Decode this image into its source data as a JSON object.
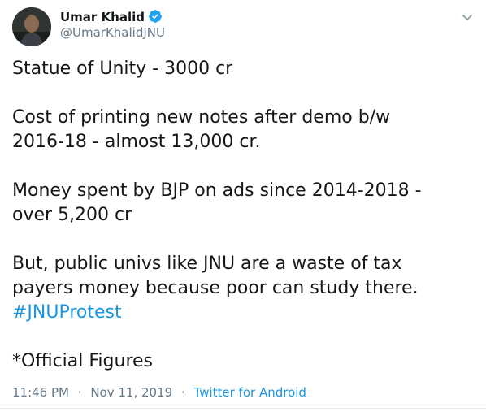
{
  "author": {
    "name": "Umar Khalid",
    "handle": "@UmarKhalidJNU",
    "verified_color": "#1da1f2"
  },
  "tweet": {
    "paragraphs": [
      [
        "Statue of Unity - 3000 cr"
      ],
      [
        "Cost of printing new notes after demo b/w",
        "2016-18 - almost 13,000 cr."
      ],
      [
        "Money spent by BJP on ads since 2014-2018 -",
        "over 5,200 cr"
      ],
      [
        "But, public univs like JNU are a waste of tax",
        "payers money because poor can study there."
      ]
    ],
    "hashtag": "#JNUProtest",
    "footnote": "*Official Figures"
  },
  "meta": {
    "time": "11:46 PM",
    "separator": "·",
    "date": "Nov 11, 2019",
    "source": "Twitter for Android"
  },
  "colors": {
    "link": "#1b95e0",
    "secondary_text": "#657786",
    "primary_text": "#14171a"
  },
  "icons": {
    "verified": "verified-badge-icon",
    "menu": "chevron-down-icon"
  }
}
